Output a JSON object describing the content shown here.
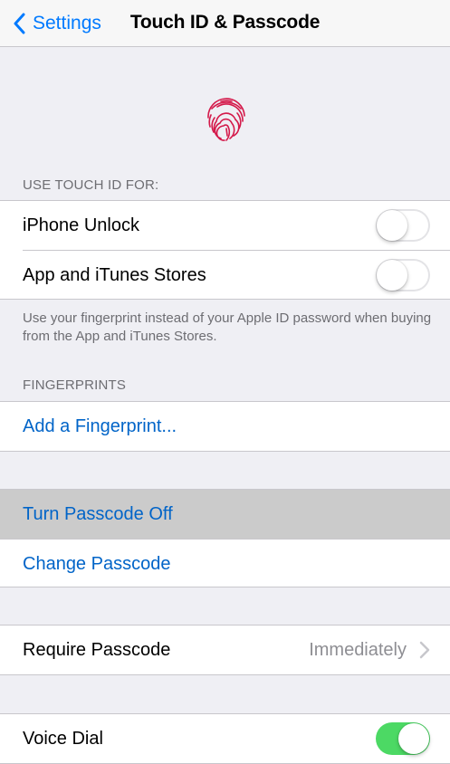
{
  "navbar": {
    "back_label": "Settings",
    "title": "Touch ID & Passcode"
  },
  "icons": {
    "back": "chevron-left-icon",
    "fingerprint": "fingerprint-icon",
    "disclosure": "chevron-right-icon"
  },
  "colors": {
    "accent": "#007aff",
    "link": "#0064c8",
    "toggle_on": "#4cd964",
    "background": "#efeff4"
  },
  "touch_id": {
    "header": "USE TOUCH ID FOR:",
    "items": [
      {
        "label": "iPhone Unlock",
        "enabled": false
      },
      {
        "label": "App and iTunes Stores",
        "enabled": false
      }
    ],
    "footer": "Use your fingerprint instead of your Apple ID password when buying from the App and iTunes Stores."
  },
  "fingerprints": {
    "header": "FINGERPRINTS",
    "add_label": "Add a Fingerprint..."
  },
  "passcode": {
    "turn_off_label": "Turn Passcode Off",
    "change_label": "Change Passcode"
  },
  "require_passcode": {
    "label": "Require Passcode",
    "value": "Immediately"
  },
  "voice_dial": {
    "label": "Voice Dial",
    "enabled": true
  }
}
